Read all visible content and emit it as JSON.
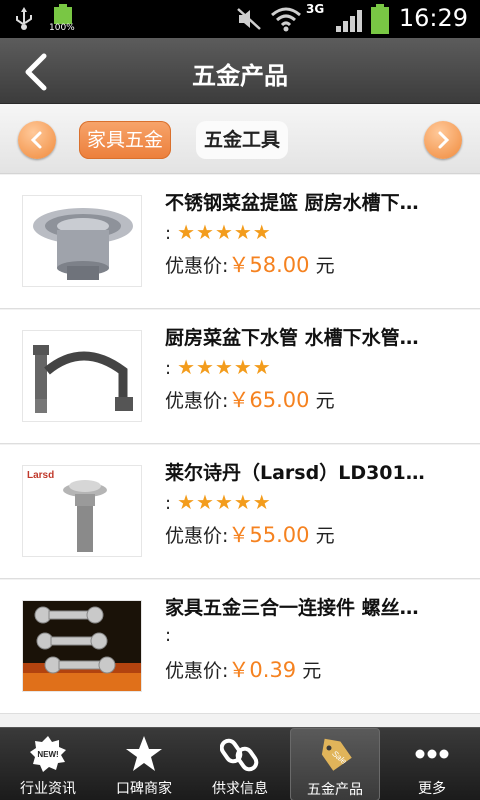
{
  "status_bar": {
    "battery_percent": "100%",
    "network": "3G",
    "time": "16:29"
  },
  "header": {
    "back_icon": "chevron-left-icon",
    "title": "五金产品"
  },
  "categories": {
    "tabs": [
      {
        "label": "家具五金",
        "active": true
      },
      {
        "label": "五金工具",
        "active": false
      }
    ]
  },
  "products": [
    {
      "name": "不锈钢菜盆提篮 厨房水槽下…",
      "rating_prefix": ":",
      "stars": 5,
      "price_label": "优惠价:",
      "price": "￥58.00",
      "unit": "元"
    },
    {
      "name": "厨房菜盆下水管 水槽下水管…",
      "rating_prefix": ":",
      "stars": 5,
      "price_label": "优惠价:",
      "price": "￥65.00",
      "unit": "元"
    },
    {
      "name": "莱尔诗丹（Larsd）LD301…",
      "rating_prefix": ":",
      "stars": 5,
      "price_label": "优惠价:",
      "price": "￥55.00",
      "unit": "元",
      "image_text": "Larsd"
    },
    {
      "name": "家具五金三合一连接件 螺丝…",
      "rating_prefix": ":",
      "stars": 0,
      "price_label": "优惠价:",
      "price": "￥0.39",
      "unit": "元"
    }
  ],
  "tabbar": {
    "tabs": [
      {
        "label": "行业资讯",
        "icon": "news-badge-icon",
        "badge": "NEW!"
      },
      {
        "label": "口碑商家",
        "icon": "star-icon"
      },
      {
        "label": "供求信息",
        "icon": "chain-link-icon"
      },
      {
        "label": "五金产品",
        "icon": "sale-tag-icon",
        "badge": "Sale",
        "selected": true
      },
      {
        "label": "更多",
        "icon": "more-dots-icon"
      }
    ]
  },
  "colors": {
    "accent_orange": "#ec7f3b",
    "price_orange": "#f58220",
    "star_orange": "#f39c1c"
  }
}
